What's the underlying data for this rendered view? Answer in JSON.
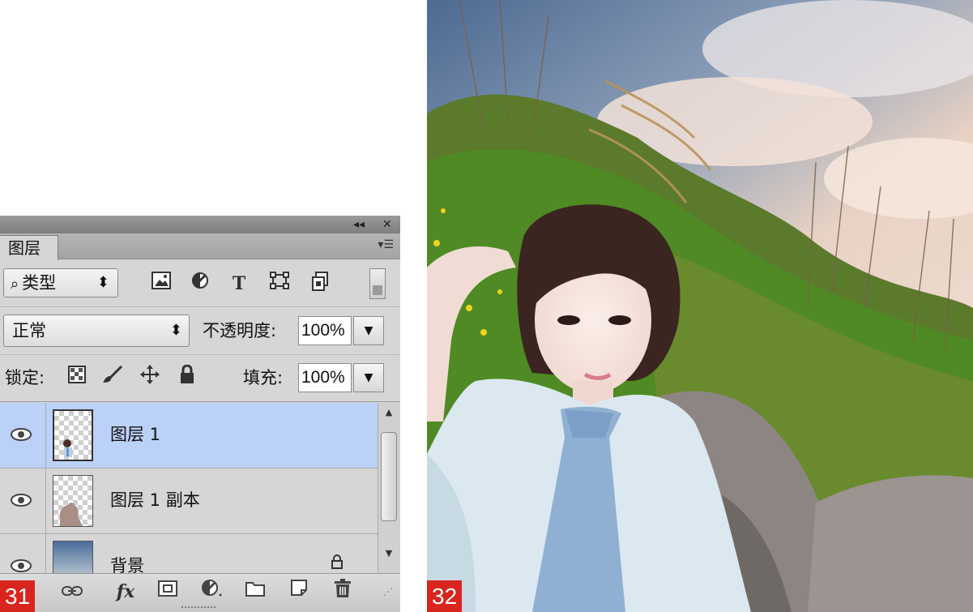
{
  "panel": {
    "title_controls": {
      "collapse": "◂◂",
      "close": "✕"
    },
    "tab_label": "图层",
    "panel_menu_icon": "panel-menu-icon",
    "filter": {
      "kind_label": "类型",
      "arrows": "⬍"
    },
    "filter_icons": [
      "image-filter-icon",
      "adjustment-filter-icon",
      "type-filter-icon",
      "shape-filter-icon",
      "smart-object-filter-icon"
    ],
    "filter_type_glyph": "T",
    "blend_mode": "正常",
    "opacity_label": "不透明度:",
    "opacity_value": "100%",
    "lock_label": "锁定:",
    "fill_label": "填充:",
    "fill_value": "100%",
    "layers": [
      {
        "name": "图层 1",
        "selected": true
      },
      {
        "name": "图层 1 副本",
        "selected": false
      },
      {
        "name": "背景",
        "selected": false,
        "locked": true
      }
    ],
    "bottom_icons": [
      "link-layers-icon",
      "fx-icon",
      "layer-mask-icon",
      "adjustment-layer-icon",
      "group-folder-icon",
      "new-layer-icon",
      "trash-icon"
    ],
    "fx_label": "fx"
  },
  "figure_labels": {
    "left": "31",
    "right": "32"
  },
  "colors": {
    "selected_layer": "#bcd1f7",
    "figure_label_bg": "#d8251d",
    "panel_bg": "#d6d6d6"
  }
}
